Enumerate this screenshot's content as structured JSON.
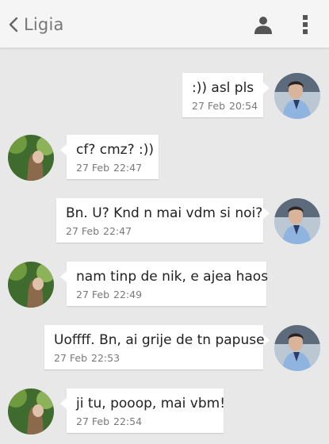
{
  "header": {
    "title": "Ligia",
    "back_icon": "chevron-left-icon",
    "contact_icon": "person-icon",
    "menu_icon": "more-vert-icon"
  },
  "colors": {
    "header_bg": "#f5f5f5",
    "chat_bg": "#e8e8e8",
    "bubble_bg": "#ffffff",
    "icon": "#555555"
  },
  "messages": [
    {
      "side": "sent",
      "text": ":)) asl pls",
      "date": "27 Feb",
      "time": "20:54"
    },
    {
      "side": "received",
      "text": "cf? cmz? :))",
      "date": "27 Feb",
      "time": "22:47"
    },
    {
      "side": "sent",
      "text": "Bn. U? Knd n mai vdm si noi?",
      "date": "27 Feb",
      "time": "22:47"
    },
    {
      "side": "received",
      "text": "nam tinp de nik, e ajea haos",
      "date": "27 Feb",
      "time": "22:49"
    },
    {
      "side": "sent",
      "text": "Uoffff. Bn, ai grije de tn papuse",
      "date": "27 Feb",
      "time": "22:53"
    },
    {
      "side": "received",
      "text": "ji tu, pooop, mai vbm!",
      "date": "27 Feb",
      "time": "22:54"
    }
  ]
}
